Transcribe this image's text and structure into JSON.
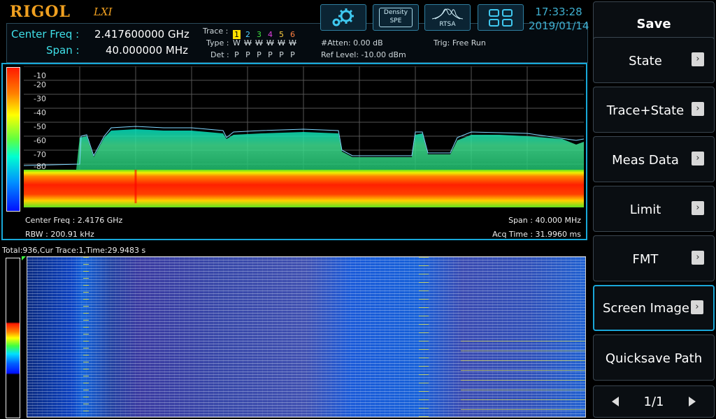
{
  "brand": {
    "name": "RIGOL",
    "sub": "LXI"
  },
  "header": {
    "center_freq_label": "Center Freq :",
    "center_freq_value": "2.417600000 GHz",
    "span_label": "Span :",
    "span_value": "40.000000 MHz",
    "trace_label": "Trace :",
    "type_label": "Type :",
    "det_label": "Det :",
    "traces": [
      {
        "num": "1",
        "color": "#ffe000",
        "type": "W",
        "det": "P"
      },
      {
        "num": "2",
        "color": "#4fd0ff",
        "type": "W",
        "det": "P"
      },
      {
        "num": "3",
        "color": "#40e040",
        "type": "W",
        "det": "P"
      },
      {
        "num": "4",
        "color": "#e040e0",
        "type": "W",
        "det": "P"
      },
      {
        "num": "5",
        "color": "#ffd040",
        "type": "W",
        "det": "P"
      },
      {
        "num": "6",
        "color": "#ff8040",
        "type": "W",
        "det": "P"
      }
    ],
    "atten": "#Atten: 0.00 dB",
    "ref_level": "Ref Level: -10.00 dBm",
    "trig": "Trig: Free Run"
  },
  "toolbar": {
    "density_label": "Density",
    "spe_label": "SPE",
    "rtsa_label": "RTSA",
    "time": "17:33:28",
    "date": "2019/01/14"
  },
  "spectrum": {
    "yticks": [
      "-10",
      "-20",
      "-30",
      "-40",
      "-50",
      "-60",
      "-70",
      "-80"
    ],
    "center_freq": "Center Freq : 2.4176 GHz",
    "rbw": "RBW : 200.91 kHz",
    "span": "Span : 40.000 MHz",
    "acq_time": "Acq Time : 31.9960 ms"
  },
  "waterfall": {
    "title": "Total:936,Cur Trace:1,Time:29.9483 s"
  },
  "menu": {
    "items": [
      {
        "label": "Save"
      },
      {
        "label": "State"
      },
      {
        "label": "Trace+State"
      },
      {
        "label": "Meas Data"
      },
      {
        "label": "Limit"
      },
      {
        "label": "FMT"
      },
      {
        "label": "Screen Image"
      },
      {
        "label": "Quicksave Path"
      }
    ],
    "page": "1/1"
  },
  "colors": {
    "accent": "#18a8d8",
    "brand": "#f0a020",
    "label": "#3fe0e8"
  }
}
